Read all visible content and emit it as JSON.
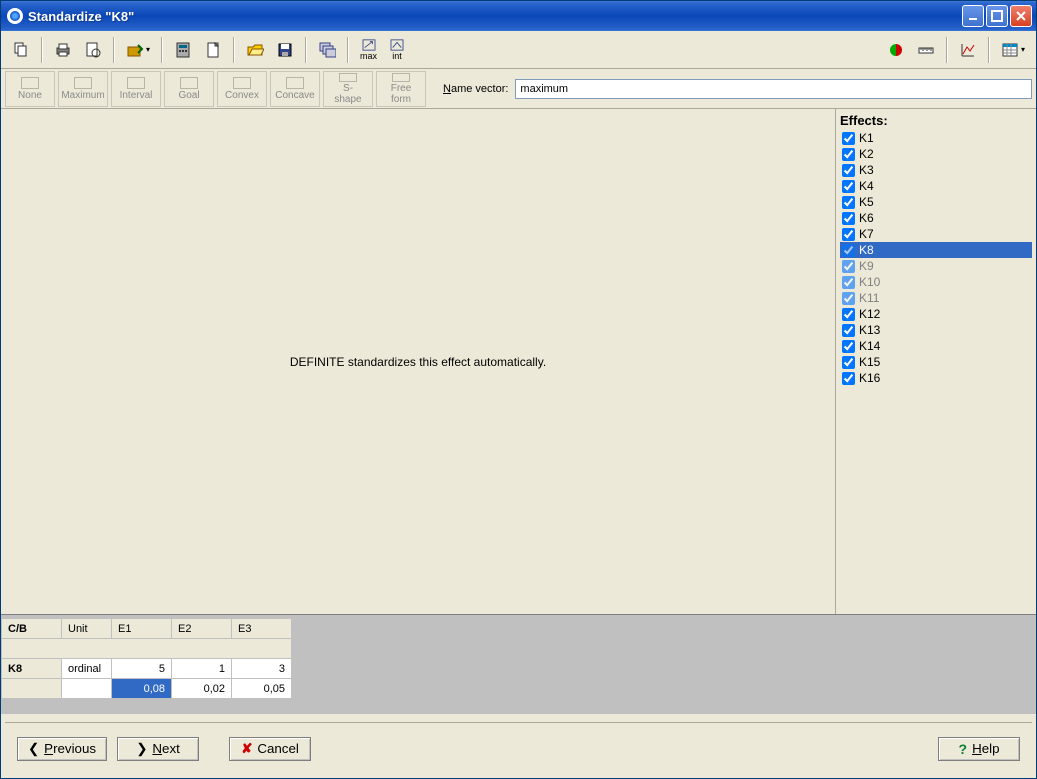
{
  "window": {
    "title": "Standardize \"K8\""
  },
  "toolbar": {
    "max_label": "max",
    "int_label": "int"
  },
  "shape_buttons": [
    "None",
    "Maximum",
    "Interval",
    "Goal",
    "Convex",
    "Concave",
    "S-shape",
    "Free form"
  ],
  "name_vector": {
    "label_pre": "N",
    "label_post": "ame vector:",
    "value": "maximum"
  },
  "canvas": {
    "message": "DEFINITE standardizes this effect automatically."
  },
  "effects": {
    "header": "Effects:",
    "items": [
      {
        "label": "K1",
        "checked": true,
        "dim": false,
        "selected": false
      },
      {
        "label": "K2",
        "checked": true,
        "dim": false,
        "selected": false
      },
      {
        "label": "K3",
        "checked": true,
        "dim": false,
        "selected": false
      },
      {
        "label": "K4",
        "checked": true,
        "dim": false,
        "selected": false
      },
      {
        "label": "K5",
        "checked": true,
        "dim": false,
        "selected": false
      },
      {
        "label": "K6",
        "checked": true,
        "dim": false,
        "selected": false
      },
      {
        "label": "K7",
        "checked": true,
        "dim": false,
        "selected": false
      },
      {
        "label": "K8",
        "checked": true,
        "dim": true,
        "selected": true
      },
      {
        "label": "K9",
        "checked": true,
        "dim": true,
        "selected": false
      },
      {
        "label": "K10",
        "checked": true,
        "dim": true,
        "selected": false
      },
      {
        "label": "K11",
        "checked": true,
        "dim": true,
        "selected": false
      },
      {
        "label": "K12",
        "checked": true,
        "dim": false,
        "selected": false
      },
      {
        "label": "K13",
        "checked": true,
        "dim": false,
        "selected": false
      },
      {
        "label": "K14",
        "checked": true,
        "dim": false,
        "selected": false
      },
      {
        "label": "K15",
        "checked": true,
        "dim": false,
        "selected": false
      },
      {
        "label": "K16",
        "checked": true,
        "dim": false,
        "selected": false
      }
    ]
  },
  "table": {
    "headers": [
      "C/B",
      "Unit",
      "E1",
      "E2",
      "E3"
    ],
    "row_label": "K8",
    "row1": {
      "cb": "",
      "unit": "ordinal",
      "e1": "5",
      "e2": "1",
      "e3": "3"
    },
    "row2": {
      "e1": "0,08",
      "e2": "0,02",
      "e3": "0,05",
      "e1_selected": true
    }
  },
  "footer": {
    "previous_label": "Previous",
    "next_label": "Next",
    "cancel_label": "Cancel",
    "help_label": "Help"
  }
}
